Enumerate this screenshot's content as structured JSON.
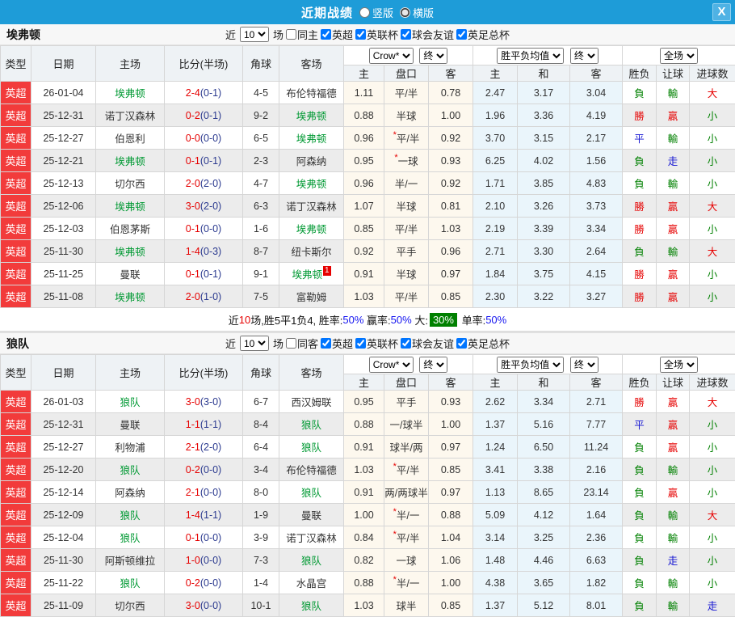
{
  "titlebar": {
    "title": "近期战绩",
    "close_glyph": "X",
    "options": [
      {
        "label": "竖版",
        "checked": false
      },
      {
        "label": "横版",
        "checked": true
      }
    ]
  },
  "colors": {
    "titlebar_blue": "#1e9cd8",
    "league_badge_red": "#f23b3b",
    "selected_team_green": "#009933",
    "score_fulltime_red": "#e60000",
    "score_halftime_blue": "#2b3a8f",
    "win_red": "#e60000",
    "lose_green": "#008000",
    "draw_blue": "#1414d2",
    "handicap_col_cream": "#fdf8ee",
    "avg_col_blue": "#eaf5fb",
    "big_badge_green": "#008000"
  },
  "columns": {
    "type": "类型",
    "date": "日期",
    "home": "主场",
    "score": "比分(半场)",
    "corner": "角球",
    "away": "客场",
    "odds_home": "主",
    "odds_line": "盘口",
    "odds_away": "客",
    "avg_home": "主",
    "avg_draw": "和",
    "avg_away": "客",
    "result": "胜负",
    "handicap": "让球",
    "goals": "进球数"
  },
  "header_controls": {
    "bookmaker": "Crow*",
    "final_a": "终",
    "avg": "胜平负均值",
    "final_b": "终",
    "scope": "全场"
  },
  "sections": [
    {
      "team": "埃弗顿",
      "filter": {
        "near_label": "近",
        "games": "10",
        "games_label": "场",
        "same_label": "同主",
        "same_checked": false,
        "leagues": [
          {
            "label": "英超",
            "checked": true
          },
          {
            "label": "英联杯",
            "checked": true
          },
          {
            "label": "球会友谊",
            "checked": true
          },
          {
            "label": "英足总杯",
            "checked": true
          }
        ]
      },
      "rows": [
        {
          "league": "英超",
          "date": "26-01-04",
          "home": "埃弗顿",
          "home_sel": true,
          "ft": "2-4",
          "ht": "(0-1)",
          "corner": "4-5",
          "away": "布伦特福德",
          "away_sel": false,
          "h_odds": "1.11",
          "line": "平/半",
          "line_star": false,
          "a_odds": "0.78",
          "avg_h": "2.47",
          "avg_d": "3.17",
          "avg_a": "3.04",
          "wl": [
            "負",
            "g"
          ],
          "hc": [
            "輸",
            "g"
          ],
          "goal": [
            "大",
            "r"
          ]
        },
        {
          "league": "英超",
          "date": "25-12-31",
          "home": "诺丁汉森林",
          "home_sel": false,
          "ft": "0-2",
          "ht": "(0-1)",
          "corner": "9-2",
          "away": "埃弗顿",
          "away_sel": true,
          "h_odds": "0.88",
          "line": "半球",
          "line_star": false,
          "a_odds": "1.00",
          "avg_h": "1.96",
          "avg_d": "3.36",
          "avg_a": "4.19",
          "wl": [
            "勝",
            "r"
          ],
          "hc": [
            "贏",
            "r"
          ],
          "goal": [
            "小",
            "g"
          ]
        },
        {
          "league": "英超",
          "date": "25-12-27",
          "home": "伯恩利",
          "home_sel": false,
          "ft": "0-0",
          "ht": "(0-0)",
          "corner": "6-5",
          "away": "埃弗顿",
          "away_sel": true,
          "h_odds": "0.96",
          "line": "平/半",
          "line_star": true,
          "a_odds": "0.92",
          "avg_h": "3.70",
          "avg_d": "3.15",
          "avg_a": "2.17",
          "wl": [
            "平",
            "b"
          ],
          "hc": [
            "輸",
            "g"
          ],
          "goal": [
            "小",
            "g"
          ]
        },
        {
          "league": "英超",
          "date": "25-12-21",
          "home": "埃弗顿",
          "home_sel": true,
          "ft": "0-1",
          "ht": "(0-1)",
          "corner": "2-3",
          "away": "阿森纳",
          "away_sel": false,
          "h_odds": "0.95",
          "line": "一球",
          "line_star": true,
          "a_odds": "0.93",
          "avg_h": "6.25",
          "avg_d": "4.02",
          "avg_a": "1.56",
          "wl": [
            "負",
            "g"
          ],
          "hc": [
            "走",
            "b"
          ],
          "goal": [
            "小",
            "g"
          ]
        },
        {
          "league": "英超",
          "date": "25-12-13",
          "home": "切尔西",
          "home_sel": false,
          "ft": "2-0",
          "ht": "(2-0)",
          "corner": "4-7",
          "away": "埃弗顿",
          "away_sel": true,
          "h_odds": "0.96",
          "line": "半/一",
          "line_star": false,
          "a_odds": "0.92",
          "avg_h": "1.71",
          "avg_d": "3.85",
          "avg_a": "4.83",
          "wl": [
            "負",
            "g"
          ],
          "hc": [
            "輸",
            "g"
          ],
          "goal": [
            "小",
            "g"
          ]
        },
        {
          "league": "英超",
          "date": "25-12-06",
          "home": "埃弗顿",
          "home_sel": true,
          "ft": "3-0",
          "ht": "(2-0)",
          "corner": "6-3",
          "away": "诺丁汉森林",
          "away_sel": false,
          "h_odds": "1.07",
          "line": "半球",
          "line_star": false,
          "a_odds": "0.81",
          "avg_h": "2.10",
          "avg_d": "3.26",
          "avg_a": "3.73",
          "wl": [
            "勝",
            "r"
          ],
          "hc": [
            "贏",
            "r"
          ],
          "goal": [
            "大",
            "r"
          ]
        },
        {
          "league": "英超",
          "date": "25-12-03",
          "home": "伯恩茅斯",
          "home_sel": false,
          "ft": "0-1",
          "ht": "(0-0)",
          "corner": "1-6",
          "away": "埃弗顿",
          "away_sel": true,
          "h_odds": "0.85",
          "line": "平/半",
          "line_star": false,
          "a_odds": "1.03",
          "avg_h": "2.19",
          "avg_d": "3.39",
          "avg_a": "3.34",
          "wl": [
            "勝",
            "r"
          ],
          "hc": [
            "贏",
            "r"
          ],
          "goal": [
            "小",
            "g"
          ]
        },
        {
          "league": "英超",
          "date": "25-11-30",
          "home": "埃弗顿",
          "home_sel": true,
          "ft": "1-4",
          "ht": "(0-3)",
          "corner": "8-7",
          "away": "纽卡斯尔",
          "away_sel": false,
          "h_odds": "0.92",
          "line": "平手",
          "line_star": false,
          "a_odds": "0.96",
          "avg_h": "2.71",
          "avg_d": "3.30",
          "avg_a": "2.64",
          "wl": [
            "負",
            "g"
          ],
          "hc": [
            "輸",
            "g"
          ],
          "goal": [
            "大",
            "r"
          ]
        },
        {
          "league": "英超",
          "date": "25-11-25",
          "home": "曼联",
          "home_sel": false,
          "ft": "0-1",
          "ht": "(0-1)",
          "corner": "9-1",
          "away": "埃弗顿",
          "away_sel": true,
          "away_badge": "1",
          "h_odds": "0.91",
          "line": "半球",
          "line_star": false,
          "a_odds": "0.97",
          "avg_h": "1.84",
          "avg_d": "3.75",
          "avg_a": "4.15",
          "wl": [
            "勝",
            "r"
          ],
          "hc": [
            "贏",
            "r"
          ],
          "goal": [
            "小",
            "g"
          ]
        },
        {
          "league": "英超",
          "date": "25-11-08",
          "home": "埃弗顿",
          "home_sel": true,
          "ft": "2-0",
          "ht": "(1-0)",
          "corner": "7-5",
          "away": "富勒姆",
          "away_sel": false,
          "h_odds": "1.03",
          "line": "平/半",
          "line_star": false,
          "a_odds": "0.85",
          "avg_h": "2.30",
          "avg_d": "3.22",
          "avg_a": "3.27",
          "wl": [
            "勝",
            "r"
          ],
          "hc": [
            "贏",
            "r"
          ],
          "goal": [
            "小",
            "g"
          ]
        }
      ],
      "summary": {
        "near": "近",
        "games": "10",
        "mid": "场,胜5平1负4, ",
        "win_label": "胜率:",
        "win": "50%",
        "profit_label": " 赢率:",
        "profit": "50%",
        "big_label": " 大:",
        "big": "30%",
        "single_label": " 单率:",
        "single": "50%"
      }
    },
    {
      "team": "狼队",
      "filter": {
        "near_label": "近",
        "games": "10",
        "games_label": "场",
        "same_label": "同客",
        "same_checked": false,
        "leagues": [
          {
            "label": "英超",
            "checked": true
          },
          {
            "label": "英联杯",
            "checked": true
          },
          {
            "label": "球会友谊",
            "checked": true
          },
          {
            "label": "英足总杯",
            "checked": true
          }
        ]
      },
      "rows": [
        {
          "league": "英超",
          "date": "26-01-03",
          "home": "狼队",
          "home_sel": true,
          "ft": "3-0",
          "ht": "(3-0)",
          "corner": "6-7",
          "away": "西汉姆联",
          "away_sel": false,
          "h_odds": "0.95",
          "line": "平手",
          "line_star": false,
          "a_odds": "0.93",
          "avg_h": "2.62",
          "avg_d": "3.34",
          "avg_a": "2.71",
          "wl": [
            "勝",
            "r"
          ],
          "hc": [
            "贏",
            "r"
          ],
          "goal": [
            "大",
            "r"
          ]
        },
        {
          "league": "英超",
          "date": "25-12-31",
          "home": "曼联",
          "home_sel": false,
          "ft": "1-1",
          "ht": "(1-1)",
          "corner": "8-4",
          "away": "狼队",
          "away_sel": true,
          "h_odds": "0.88",
          "line": "一/球半",
          "line_star": false,
          "a_odds": "1.00",
          "avg_h": "1.37",
          "avg_d": "5.16",
          "avg_a": "7.77",
          "wl": [
            "平",
            "b"
          ],
          "hc": [
            "贏",
            "r"
          ],
          "goal": [
            "小",
            "g"
          ]
        },
        {
          "league": "英超",
          "date": "25-12-27",
          "home": "利物浦",
          "home_sel": false,
          "ft": "2-1",
          "ht": "(2-0)",
          "corner": "6-4",
          "away": "狼队",
          "away_sel": true,
          "h_odds": "0.91",
          "line": "球半/两",
          "line_star": false,
          "a_odds": "0.97",
          "avg_h": "1.24",
          "avg_d": "6.50",
          "avg_a": "11.24",
          "wl": [
            "負",
            "g"
          ],
          "hc": [
            "贏",
            "r"
          ],
          "goal": [
            "小",
            "g"
          ]
        },
        {
          "league": "英超",
          "date": "25-12-20",
          "home": "狼队",
          "home_sel": true,
          "ft": "0-2",
          "ht": "(0-0)",
          "corner": "3-4",
          "away": "布伦特福德",
          "away_sel": false,
          "h_odds": "1.03",
          "line": "平/半",
          "line_star": true,
          "a_odds": "0.85",
          "avg_h": "3.41",
          "avg_d": "3.38",
          "avg_a": "2.16",
          "wl": [
            "負",
            "g"
          ],
          "hc": [
            "輸",
            "g"
          ],
          "goal": [
            "小",
            "g"
          ]
        },
        {
          "league": "英超",
          "date": "25-12-14",
          "home": "阿森纳",
          "home_sel": false,
          "ft": "2-1",
          "ht": "(0-0)",
          "corner": "8-0",
          "away": "狼队",
          "away_sel": true,
          "h_odds": "0.91",
          "line": "两/两球半",
          "line_star": false,
          "a_odds": "0.97",
          "avg_h": "1.13",
          "avg_d": "8.65",
          "avg_a": "23.14",
          "wl": [
            "負",
            "g"
          ],
          "hc": [
            "贏",
            "r"
          ],
          "goal": [
            "小",
            "g"
          ]
        },
        {
          "league": "英超",
          "date": "25-12-09",
          "home": "狼队",
          "home_sel": true,
          "ft": "1-4",
          "ht": "(1-1)",
          "corner": "1-9",
          "away": "曼联",
          "away_sel": false,
          "h_odds": "1.00",
          "line": "半/一",
          "line_star": true,
          "a_odds": "0.88",
          "avg_h": "5.09",
          "avg_d": "4.12",
          "avg_a": "1.64",
          "wl": [
            "負",
            "g"
          ],
          "hc": [
            "輸",
            "g"
          ],
          "goal": [
            "大",
            "r"
          ]
        },
        {
          "league": "英超",
          "date": "25-12-04",
          "home": "狼队",
          "home_sel": true,
          "ft": "0-1",
          "ht": "(0-0)",
          "corner": "3-9",
          "away": "诺丁汉森林",
          "away_sel": false,
          "h_odds": "0.84",
          "line": "平/半",
          "line_star": true,
          "a_odds": "1.04",
          "avg_h": "3.14",
          "avg_d": "3.25",
          "avg_a": "2.36",
          "wl": [
            "負",
            "g"
          ],
          "hc": [
            "輸",
            "g"
          ],
          "goal": [
            "小",
            "g"
          ]
        },
        {
          "league": "英超",
          "date": "25-11-30",
          "home": "阿斯顿维拉",
          "home_sel": false,
          "ft": "1-0",
          "ht": "(0-0)",
          "corner": "7-3",
          "away": "狼队",
          "away_sel": true,
          "h_odds": "0.82",
          "line": "一球",
          "line_star": false,
          "a_odds": "1.06",
          "avg_h": "1.48",
          "avg_d": "4.46",
          "avg_a": "6.63",
          "wl": [
            "負",
            "g"
          ],
          "hc": [
            "走",
            "b"
          ],
          "goal": [
            "小",
            "g"
          ]
        },
        {
          "league": "英超",
          "date": "25-11-22",
          "home": "狼队",
          "home_sel": true,
          "ft": "0-2",
          "ht": "(0-0)",
          "corner": "1-4",
          "away": "水晶宫",
          "away_sel": false,
          "h_odds": "0.88",
          "line": "半/一",
          "line_star": true,
          "a_odds": "1.00",
          "avg_h": "4.38",
          "avg_d": "3.65",
          "avg_a": "1.82",
          "wl": [
            "負",
            "g"
          ],
          "hc": [
            "輸",
            "g"
          ],
          "goal": [
            "小",
            "g"
          ]
        },
        {
          "league": "英超",
          "date": "25-11-09",
          "home": "切尔西",
          "home_sel": false,
          "ft": "3-0",
          "ht": "(0-0)",
          "corner": "10-1",
          "away": "狼队",
          "away_sel": true,
          "h_odds": "1.03",
          "line": "球半",
          "line_star": false,
          "a_odds": "0.85",
          "avg_h": "1.37",
          "avg_d": "5.12",
          "avg_a": "8.01",
          "wl": [
            "負",
            "g"
          ],
          "hc": [
            "輸",
            "g"
          ],
          "goal": [
            "走",
            "b"
          ]
        }
      ]
    }
  ]
}
